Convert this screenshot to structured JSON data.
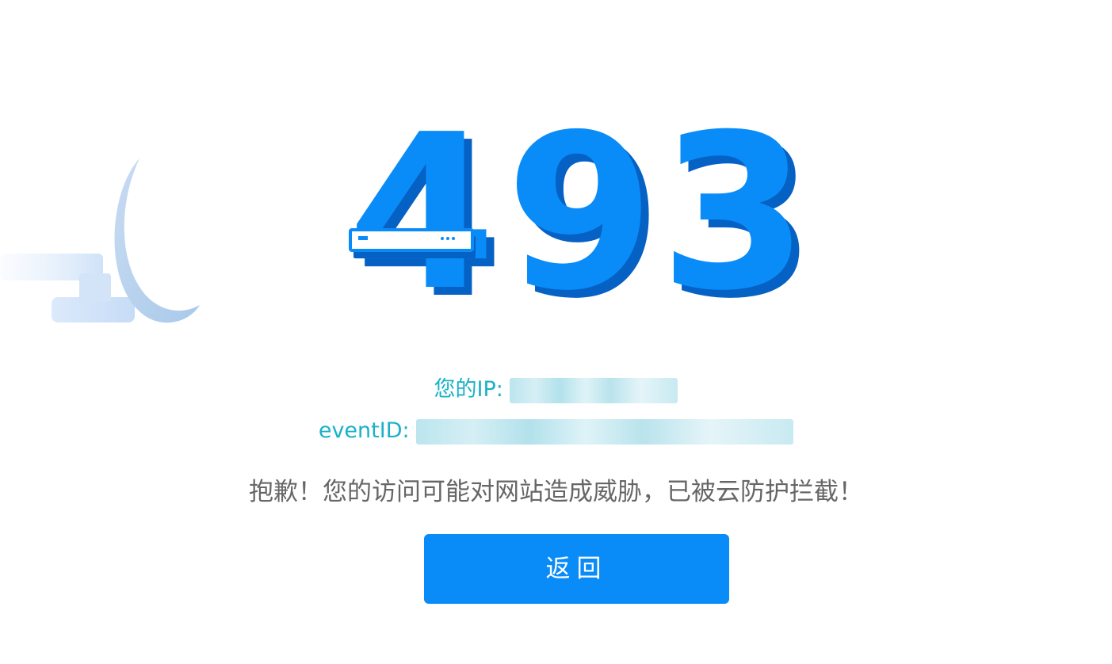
{
  "error": {
    "code_digits": [
      "4",
      "9",
      "3"
    ],
    "code_color": "#0a8cf8",
    "code_shadow_color": "#0561c4"
  },
  "info": {
    "ip_label": "您的IP:",
    "event_label": "eventID:",
    "text_color": "#1ab1c9"
  },
  "message": "抱歉！您的访问可能对网站造成威胁，已被云防护拦截！",
  "back_button": {
    "label": "返回",
    "color": "#0a8cf8"
  },
  "decoration": {
    "icon": "broom-sweep-icon",
    "color": "#b9d6f2"
  }
}
